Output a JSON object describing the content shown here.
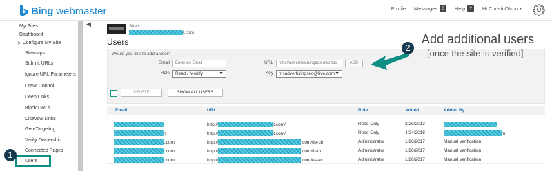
{
  "header": {
    "brand": "Bing",
    "product": "webmaster",
    "links": [
      {
        "label": "Profile",
        "badge": ""
      },
      {
        "label": "Messages",
        "badge": "0"
      },
      {
        "label": "Help",
        "badge": "?"
      },
      {
        "label": "Hi Christi Olson",
        "badge": ""
      }
    ],
    "settings_icon": "gear-icon"
  },
  "sidebar": {
    "items": [
      {
        "label": "My Sites"
      },
      {
        "label": "Dashboard"
      },
      {
        "label": "Configure My Site",
        "expand_icon": "chevron-right-icon"
      },
      {
        "label": "Sitemaps"
      },
      {
        "label": "Submit URLs"
      },
      {
        "label": "Ignore URL Parameters"
      },
      {
        "label": "Crawl Control"
      },
      {
        "label": "Deep Links"
      },
      {
        "label": "Block URLs"
      },
      {
        "label": "Disavow Links"
      },
      {
        "label": "Geo-Targeting"
      },
      {
        "label": "Verify Ownership"
      },
      {
        "label": "Connected Pages"
      },
      {
        "label": "Users"
      }
    ],
    "collapse_icon": "chevron-left-icon"
  },
  "site": {
    "label": "Site",
    "url_suffix": "t.com"
  },
  "page": {
    "title": "Users"
  },
  "add_user": {
    "question": "Would you like to add a user?",
    "email_label": "Email",
    "email_placeholder": "Enter an Email",
    "role_label": "Role",
    "role_value": "Read / Modify",
    "url_label": "URL",
    "url_value": "http://advertise.bingads.microso",
    "add_button": "ADD",
    "key_label": "Key",
    "key_value": "msadvertisingseo@live.com"
  },
  "actions": {
    "delete_label": "DELETE",
    "show_all_label": "SHOW ALL USERS"
  },
  "table": {
    "headers": [
      "Email",
      "URL",
      "Role",
      "Added",
      "Added By"
    ],
    "rows": [
      {
        "email_suffix": "",
        "url_prefix": "http://",
        "url_suffix": "t.com/",
        "role": "Read Only",
        "added": "3/29/2013",
        "added_by": "",
        "added_by_suffix": ""
      },
      {
        "email_suffix": "n",
        "url_prefix": "http://",
        "url_suffix": "t.com/",
        "role": "Read Only",
        "added": "4/24/2018",
        "added_by": "",
        "added_by_suffix": "m"
      },
      {
        "email_suffix": "t.com",
        "url_prefix": "http://",
        "url_suffix": ".com/de-ch",
        "role": "Administrator",
        "added": "1/20/2017",
        "added_by": "Manual verification",
        "added_by_suffix": ""
      },
      {
        "email_suffix": "t.com",
        "url_prefix": "http://",
        "url_suffix": ".com/th-th",
        "role": "Administrator",
        "added": "1/20/2017",
        "added_by": "Manual verification",
        "added_by_suffix": ""
      },
      {
        "email_suffix": "t.com",
        "url_prefix": "http://",
        "url_suffix": ".com/es-ar",
        "role": "Administrator",
        "added": "1/20/2017",
        "added_by": "Manual verification",
        "added_by_suffix": ""
      }
    ]
  },
  "callouts": {
    "one": {
      "number": "1"
    },
    "two": {
      "number": "2",
      "line1": "Add additional users",
      "line2": "[once the site is verified]"
    }
  },
  "colors": {
    "accent": "#1e88d3",
    "callout_teal": "#0f8f84",
    "callout_badge": "#16394f",
    "redaction": "#3bbfd8"
  }
}
